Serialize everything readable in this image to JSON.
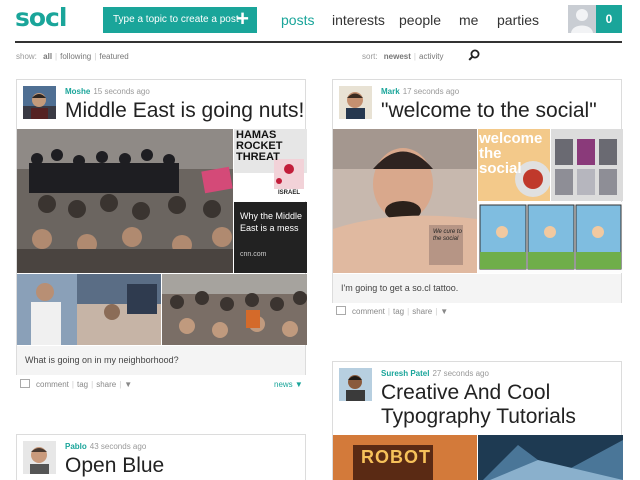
{
  "header": {
    "logo": "socl",
    "create_label": "Type a topic to create a post",
    "create_icon": "+",
    "nav": [
      "posts",
      "interests",
      "people",
      "me",
      "parties"
    ],
    "active_nav": "posts",
    "notification_count": "0"
  },
  "filter": {
    "show_label": "show:",
    "show_options": [
      "all",
      "following",
      "featured"
    ],
    "show_selected": "all",
    "sort_label": "sort:",
    "sort_options": [
      "newest",
      "activity"
    ],
    "sort_selected": "newest",
    "search_icon": "search-icon"
  },
  "posts": [
    {
      "user": "Moshe",
      "time": "15 seconds ago",
      "title": "Middle East is going nuts!",
      "link_card": {
        "title": "Why the Middle East is a mess",
        "source": "cnn.com",
        "image_text": "HAMAS ROCKET THREAT",
        "image_sub": "ISRAEL"
      },
      "caption": "What is going on in my neighborhood?",
      "actions": [
        "comment",
        "tag",
        "share"
      ],
      "tag": "news"
    },
    {
      "user": "Mark",
      "time": "17 seconds ago",
      "title": "\"welcome to the social\"",
      "tattoo_text": "We cure to the social",
      "image_text": "welcome the social",
      "caption": "I'm going to get a so.cl tattoo.",
      "actions": [
        "comment",
        "tag",
        "share"
      ]
    },
    {
      "user": "Suresh Patel",
      "time": "27 seconds ago",
      "title_lines": [
        "Creative And Cool",
        "Typography Tutorials"
      ],
      "image_text": "ROBOT"
    },
    {
      "user": "Pablo",
      "time": "43 seconds ago",
      "title": "Open Blue"
    }
  ],
  "colors": {
    "accent": "#1aa59a",
    "text": "#333333",
    "rule": "#333333"
  }
}
